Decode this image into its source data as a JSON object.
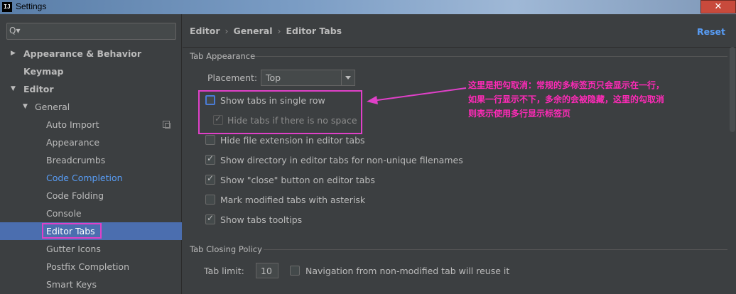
{
  "window": {
    "title": "Settings",
    "app_icon": "IJ",
    "close_glyph": "✕"
  },
  "search": {
    "icon": "search-icon",
    "glyph": "Q▾"
  },
  "sidebar": {
    "items": [
      {
        "label": "Appearance & Behavior",
        "arrow": "▶"
      },
      {
        "label": "Keymap"
      },
      {
        "label": "Editor",
        "arrow": "▼"
      },
      {
        "label": "General",
        "arrow": "▼"
      },
      {
        "label": "Auto Import"
      },
      {
        "label": "Appearance"
      },
      {
        "label": "Breadcrumbs"
      },
      {
        "label": "Code Completion"
      },
      {
        "label": "Code Folding"
      },
      {
        "label": "Console"
      },
      {
        "label": "Editor Tabs"
      },
      {
        "label": "Gutter Icons"
      },
      {
        "label": "Postfix Completion"
      },
      {
        "label": "Smart Keys"
      }
    ]
  },
  "breadcrumb": {
    "items": [
      "Editor",
      "General",
      "Editor Tabs"
    ],
    "sep": "›"
  },
  "reset_label": "Reset",
  "tab_appearance": {
    "title": "Tab Appearance",
    "placement_label": "Placement:",
    "placement_value": "Top",
    "options": [
      {
        "label": "Show tabs in single row",
        "checked": false
      },
      {
        "label": "Hide tabs if there is no space",
        "checked": true,
        "disabled": true
      },
      {
        "label": "Hide file extension in editor tabs",
        "checked": false
      },
      {
        "label": "Show directory in editor tabs for non-unique filenames",
        "checked": true
      },
      {
        "label": "Show \"close\" button on editor tabs",
        "checked": true
      },
      {
        "label": "Mark modified tabs with asterisk",
        "checked": false
      },
      {
        "label": "Show tabs tooltips",
        "checked": true
      }
    ]
  },
  "tab_closing": {
    "title": "Tab Closing Policy",
    "limit_label": "Tab limit:",
    "limit_value": "10",
    "reuse_label": "Navigation from non-modified tab will reuse it"
  },
  "annotation": {
    "lines": [
      "这里是把勾取消：常规的多标签页只会显示在一行，",
      "如果一行显示不下，多余的会被隐藏，这里的勾取消",
      "则表示使用多行显示标签页"
    ],
    "color": "#ff2ab8"
  },
  "colors": {
    "accent": "#4b6eaf",
    "link": "#589df6",
    "highlight": "#e040c8"
  },
  "check_glyph": "✓"
}
